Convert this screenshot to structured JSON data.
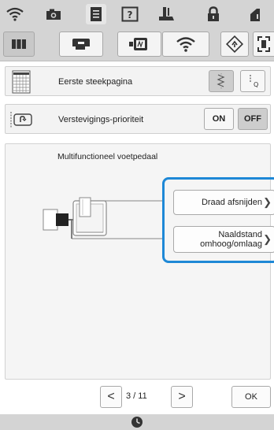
{
  "header": {
    "icons": [
      "wifi-icon",
      "camera-icon",
      "document-icon",
      "help-icon",
      "presser-foot-icon",
      "lock-icon",
      "needle-icon"
    ]
  },
  "tabs": {
    "items": [
      "settings-tab-icon",
      "machine-tab-icon",
      "embroidery-tab-icon",
      "wifi-tab-icon",
      "reset-tab-icon",
      "screen-tab-icon"
    ],
    "selected_index": 0
  },
  "row1": {
    "label": "Eerste steekpagina"
  },
  "row2": {
    "label": "Verstevigings-prioriteit",
    "on_label": "ON",
    "off_label": "OFF",
    "selected": "OFF"
  },
  "panel": {
    "title": "Multifunctioneel voetpedaal",
    "button1": "Draad afsnijden",
    "button2": "Naaldstand omhoog/omlaag"
  },
  "footer": {
    "prev": "<",
    "page": "3 / 11",
    "next": ">",
    "ok": "OK"
  },
  "colors": {
    "highlight": "#1e88d6",
    "bar": "#d4d4d4"
  }
}
